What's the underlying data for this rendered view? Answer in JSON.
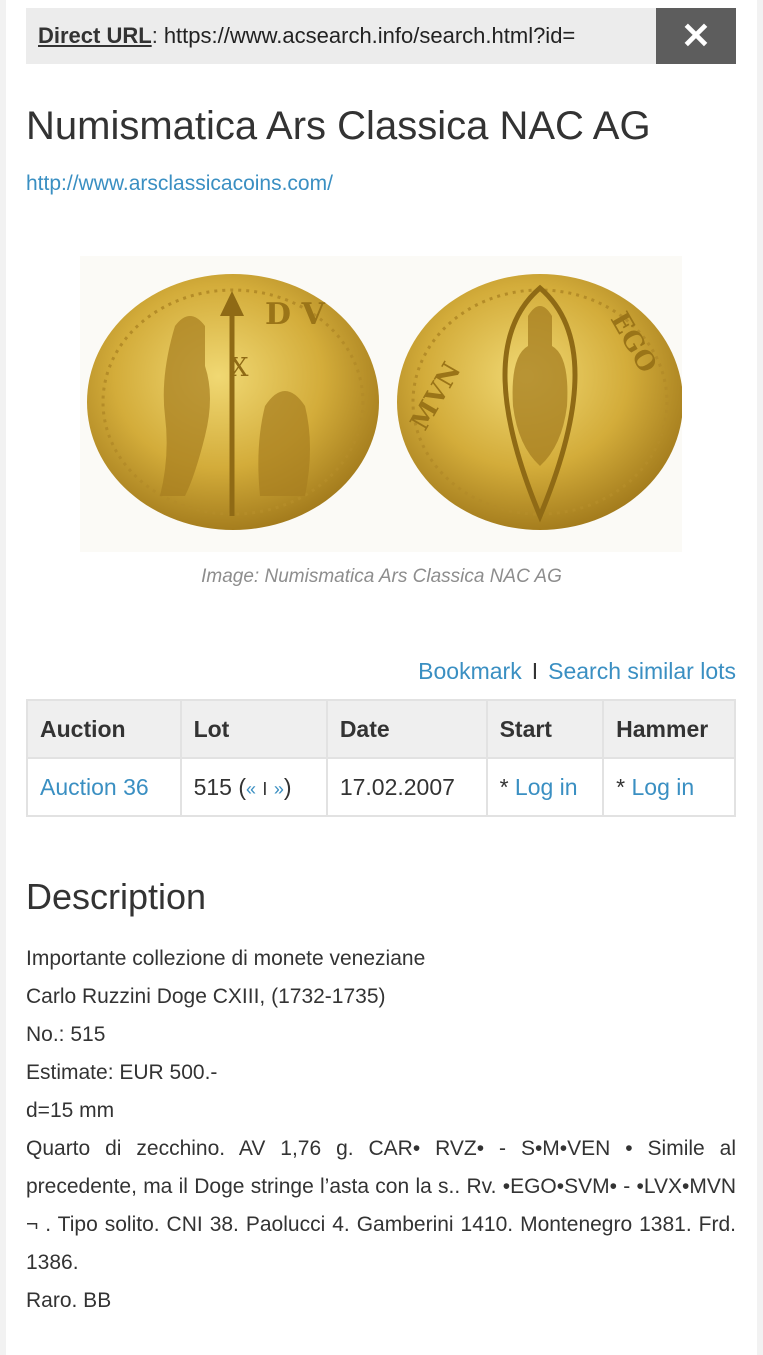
{
  "url_bar": {
    "label": "Direct URL",
    "colon": ":",
    "url": "https://www.acsearch.info/search.html?id=",
    "close_icon": "close-icon"
  },
  "header": {
    "title": "Numismatica Ars Classica NAC AG",
    "site_link": "http://www.arsclassicacoins.com/"
  },
  "image": {
    "caption": "Image: Numismatica Ars Classica NAC AG"
  },
  "actions": {
    "bookmark": "Bookmark",
    "separator": "I",
    "search_similar": "Search similar lots"
  },
  "lot_table": {
    "headers": [
      "Auction",
      "Lot",
      "Date",
      "Start",
      "Hammer"
    ],
    "row": {
      "auction": "Auction 36",
      "lot_number": "515",
      "lot_prev": "«",
      "lot_sep": "I",
      "lot_next": "»",
      "date": "17.02.2007",
      "start_prefix": "*",
      "start_link": "Log in",
      "hammer_prefix": "*",
      "hammer_link": "Log in"
    }
  },
  "description": {
    "heading": "Description",
    "lines": [
      "Importante collezione di monete veneziane",
      "Carlo Ruzzini Doge CXIII, (1732-1735)",
      "No.: 515",
      "Estimate: EUR 500.-",
      "d=15 mm"
    ],
    "body": "Quarto di zecchino. AV 1,76 g. CAR• RVZ• - S•M•VEN • Simile al precedente, ma il Doge stringe l’asta con la s.. Rv. •EGO•SVM• - •LVX•MVN ¬ . Tipo solito. CNI 38. Paolucci 4. Gamberini 1410. Montenegro 1381. Frd. 1386.",
    "grade": "Raro. BB"
  },
  "colors": {
    "link": "#3a8fc2",
    "close_bg": "#5d5d5d",
    "gold": "#c9a227"
  }
}
